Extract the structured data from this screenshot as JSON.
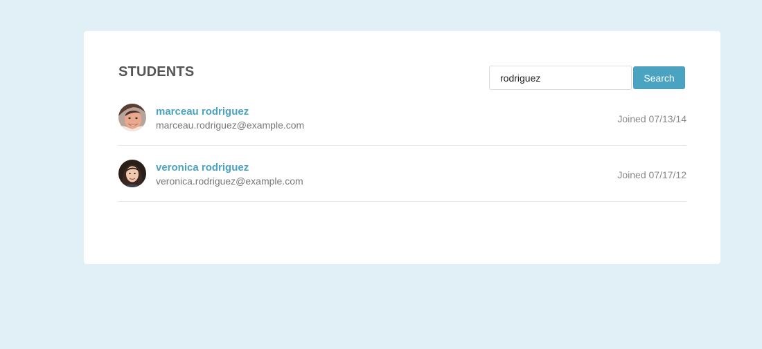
{
  "page": {
    "title": "STUDENTS",
    "background_color": "#e1f0f6",
    "accent_color": "#4aa3c1"
  },
  "search": {
    "value": "rodriguez",
    "placeholder": "",
    "button_label": "Search"
  },
  "students": [
    {
      "name": "marceau rodriguez",
      "email": "marceau.rodriguez@example.com",
      "joined": "Joined 07/13/14",
      "avatar_icon": "person-avatar"
    },
    {
      "name": "veronica rodriguez",
      "email": "veronica.rodriguez@example.com",
      "joined": "Joined 07/17/12",
      "avatar_icon": "person-avatar"
    }
  ]
}
